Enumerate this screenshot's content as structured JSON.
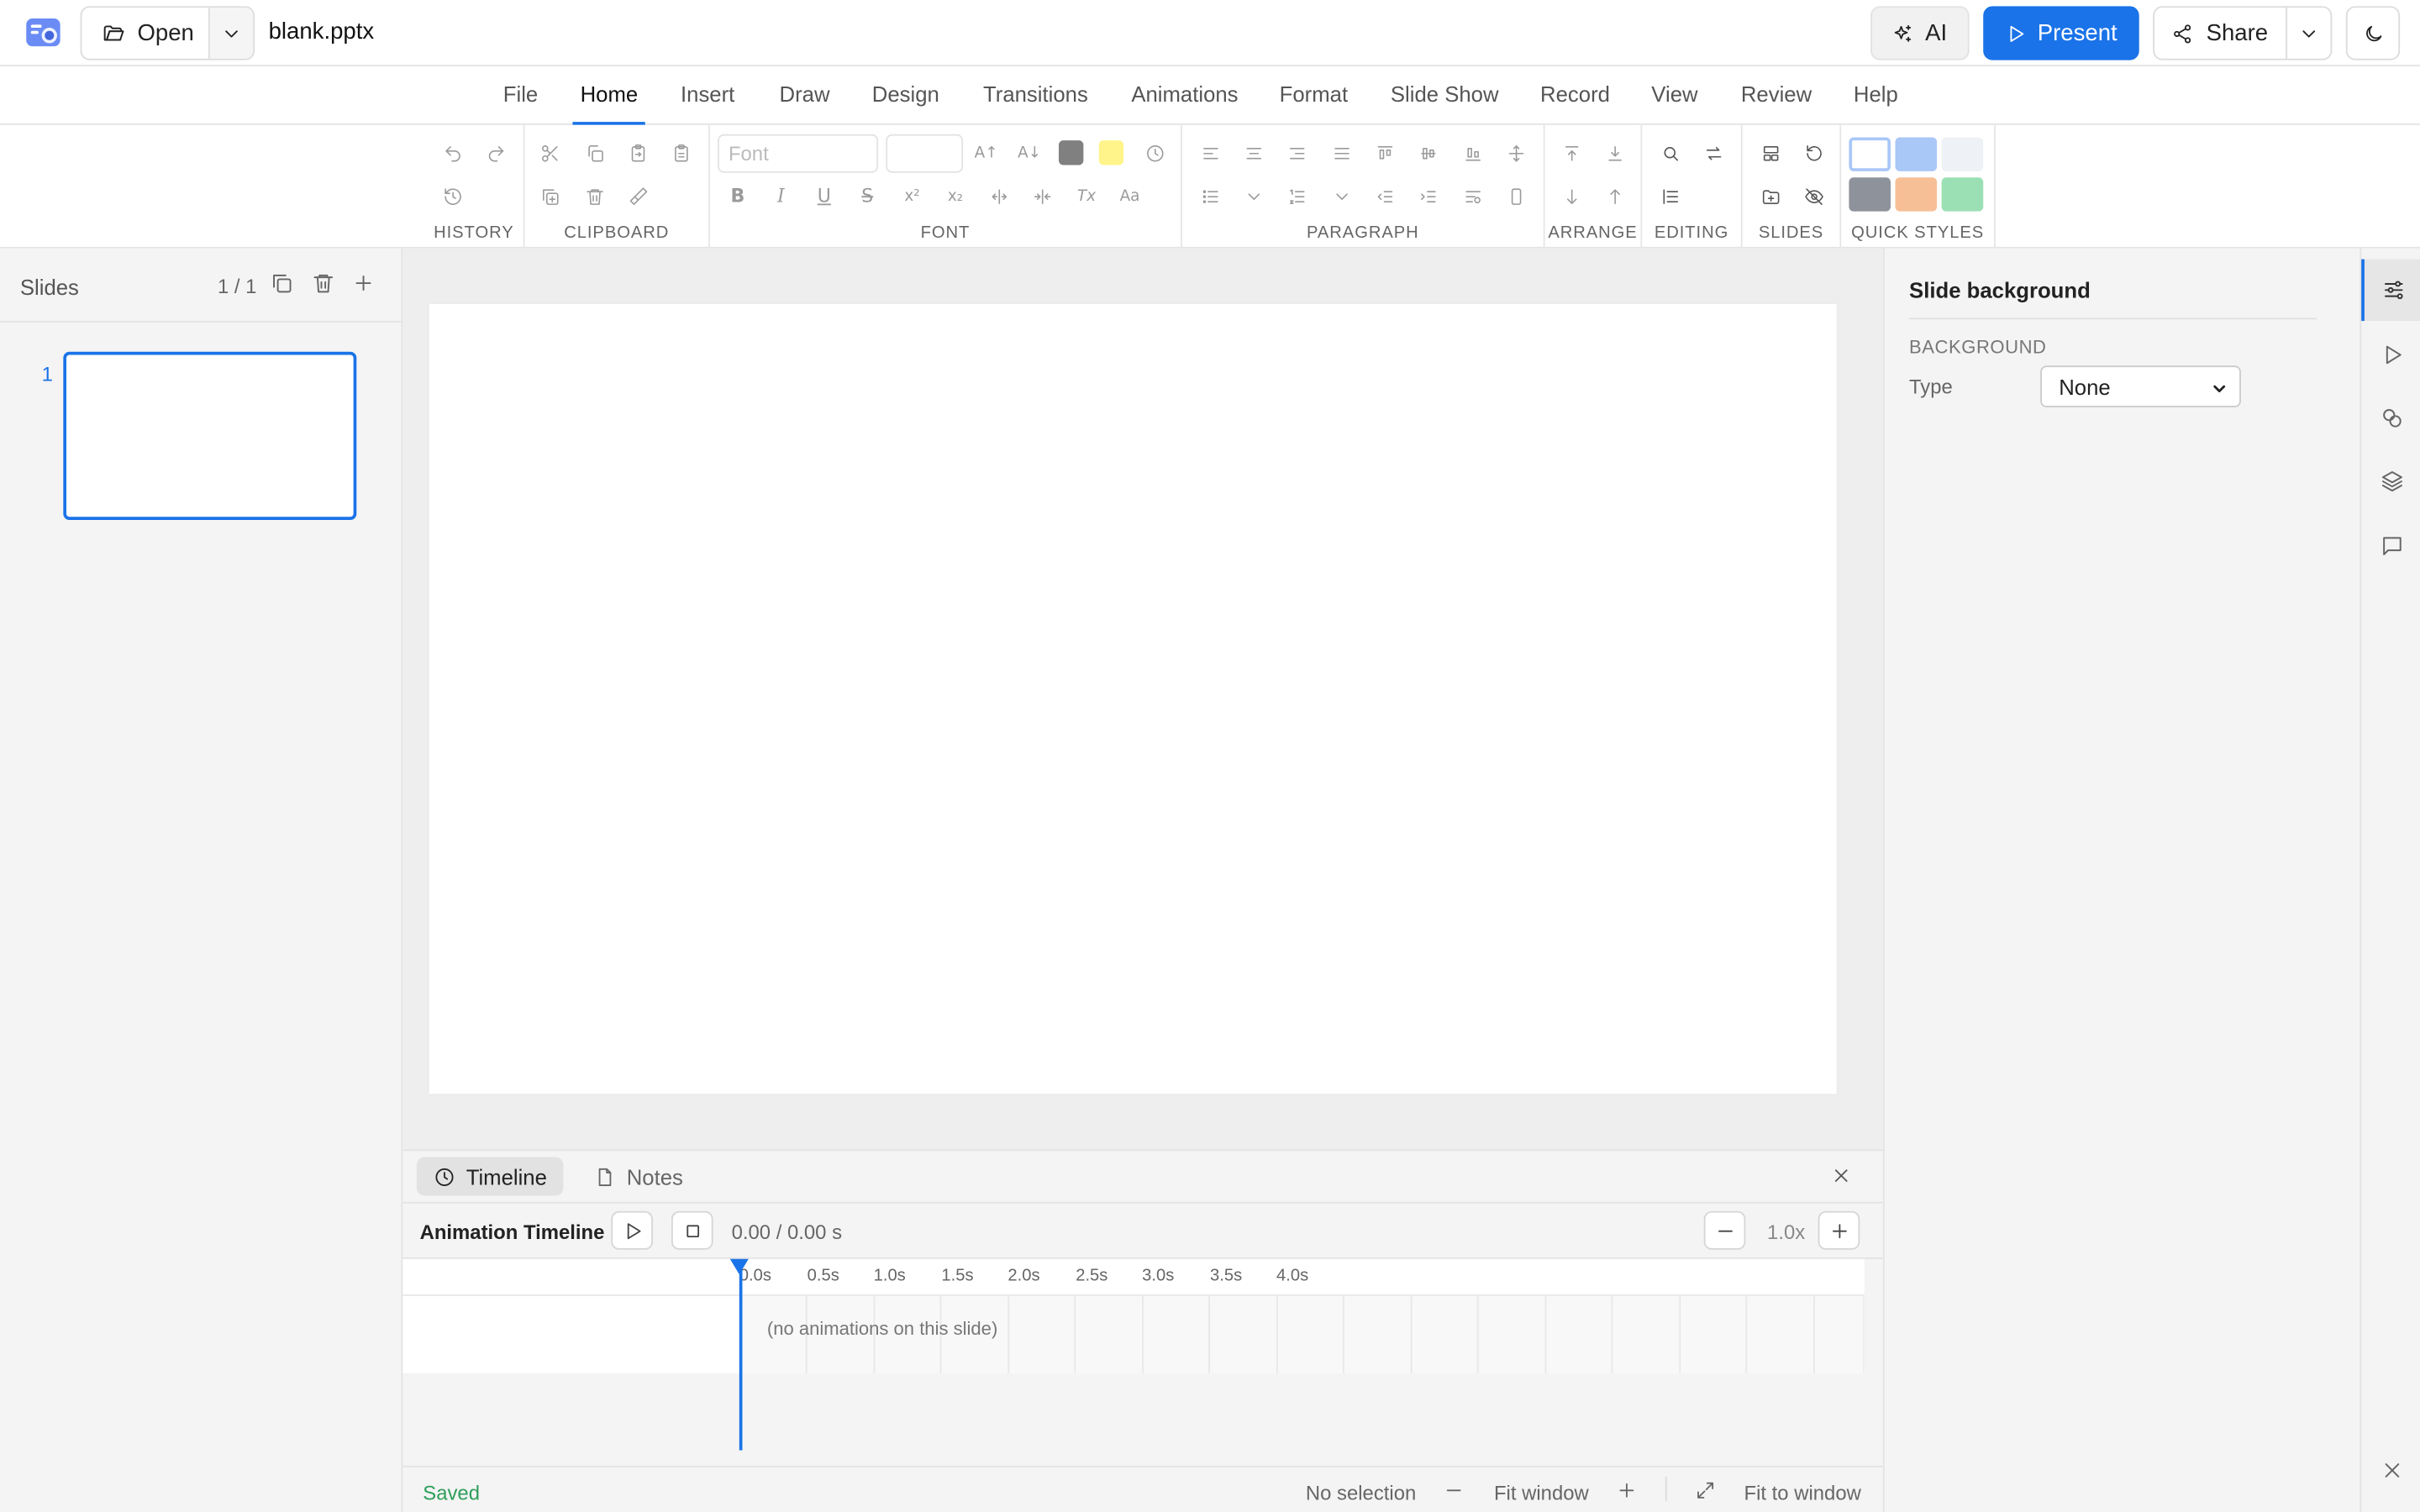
{
  "titlebar": {
    "open_label": "Open",
    "filename": "blank.pptx",
    "ai_label": "AI",
    "present_label": "Present",
    "share_label": "Share"
  },
  "menu": [
    "File",
    "Home",
    "Insert",
    "Draw",
    "Design",
    "Transitions",
    "Animations",
    "Format",
    "Slide Show",
    "Record",
    "View",
    "Review",
    "Help"
  ],
  "menu_active": "Home",
  "ribbon": {
    "groups": [
      "HISTORY",
      "CLIPBOARD",
      "FONT",
      "PARAGRAPH",
      "ARRANGE",
      "EDITING",
      "SLIDES",
      "QUICK STYLES"
    ],
    "font_placeholder": "Font",
    "font_color": "#808080",
    "highlight_color": "#fff48a",
    "quick_styles": [
      "#ffffff",
      "#a9c7f7",
      "#eef1f5",
      "#8e929a",
      "#f7bf96",
      "#9be0b4"
    ]
  },
  "slides_panel": {
    "title": "Slides",
    "count": "1 / 1",
    "slide_number": "1"
  },
  "bottom_panel": {
    "tabs": [
      "Timeline",
      "Notes"
    ],
    "timeline_title": "Animation Timeline",
    "time": "0.00 / 0.00 s",
    "zoom": "1.0x",
    "ticks": [
      "0.0s",
      "0.5s",
      "1.0s",
      "1.5s",
      "2.0s",
      "2.5s",
      "3.0s",
      "3.5s",
      "4.0s"
    ],
    "empty_message": "(no animations on this slide)"
  },
  "statusbar": {
    "saved": "Saved",
    "selection": "No selection",
    "fit_window": "Fit window",
    "fit_to_window": "Fit to window"
  },
  "right_panel": {
    "title": "Slide background",
    "section": "BACKGROUND",
    "type_label": "Type",
    "type_value": "None"
  },
  "colors": {
    "accent": "#1a73e8",
    "saved_green": "#2e9e5b"
  }
}
